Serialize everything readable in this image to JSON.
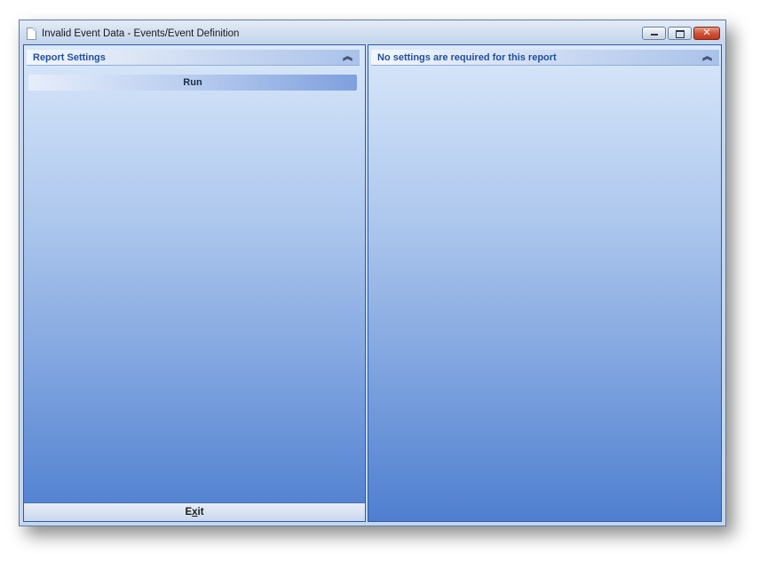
{
  "window": {
    "title": "Invalid Event Data - Events/Event Definition",
    "title_icon": "document-icon",
    "controls": {
      "minimize_icon": "minimize-icon",
      "maximize_icon": "maximize-icon",
      "close_icon": "close-icon",
      "close_glyph": "✕"
    }
  },
  "left_panel": {
    "header": "Report Settings",
    "collapse_glyph": "︽",
    "run_label": "Run",
    "exit_label_prefix": "E",
    "exit_label_mnemonic": "x",
    "exit_label_suffix": "it"
  },
  "right_panel": {
    "header": "No settings are required for this report",
    "collapse_glyph": "︽"
  },
  "colors": {
    "accent": "#2e5aa8",
    "header_text": "#1f4f9f",
    "gradient_top": "#d9e8fa",
    "gradient_bottom": "#4f7fd0",
    "close_button": "#c1381c"
  }
}
